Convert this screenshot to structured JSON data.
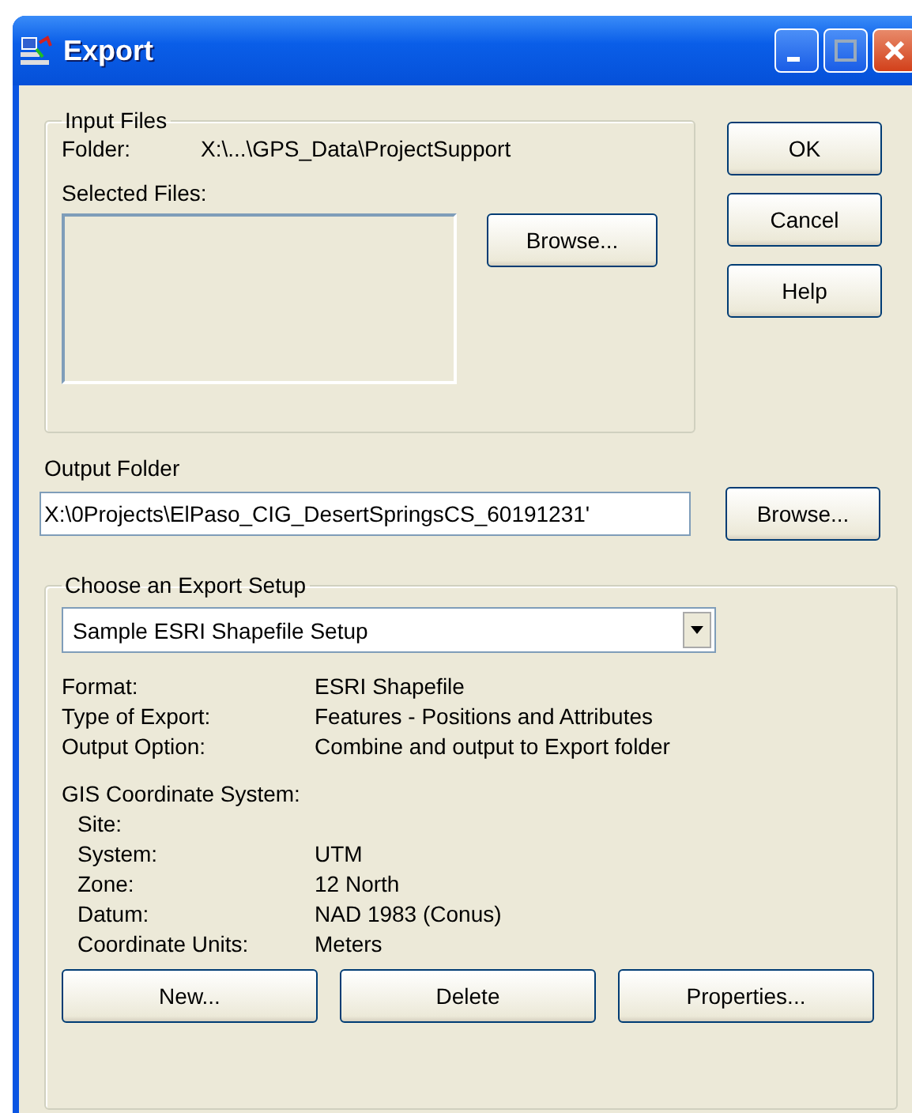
{
  "window": {
    "title": "Export"
  },
  "input_files": {
    "title": "Input Files",
    "folder_label": "Folder:",
    "folder_value": "X:\\...\\GPS_Data\\ProjectSupport",
    "selected_files_label": "Selected Files:",
    "browse_button": "Browse..."
  },
  "dialog_buttons": [
    "OK",
    "Cancel",
    "Help"
  ],
  "output_folder": {
    "label": "Output Folder",
    "value": "X:\\0Projects\\ElPaso_CIG_DesertSpringsCS_60191231'",
    "browse_button": "Browse..."
  },
  "export_setup": {
    "title": "Choose an Export Setup",
    "selected_setup": "Sample ESRI Shapefile Setup",
    "details": [
      {
        "label": "Format:",
        "value": "ESRI Shapefile"
      },
      {
        "label": "Type of Export:",
        "value": "Features - Positions and Attributes"
      },
      {
        "label": "Output Option:",
        "value": "Combine and output to Export folder"
      }
    ],
    "gis_title": "GIS Coordinate System:",
    "gis_details": [
      {
        "label": "Site:"
      },
      {
        "label": "System:",
        "value": "UTM"
      },
      {
        "label": "Zone:",
        "value": "12 North"
      },
      {
        "label": "Datum:",
        "value": "NAD 1983 (Conus)"
      },
      {
        "label": "Coordinate Units:",
        "value": "Meters"
      }
    ],
    "buttons": [
      "New...",
      "Delete",
      "Properties..."
    ]
  }
}
